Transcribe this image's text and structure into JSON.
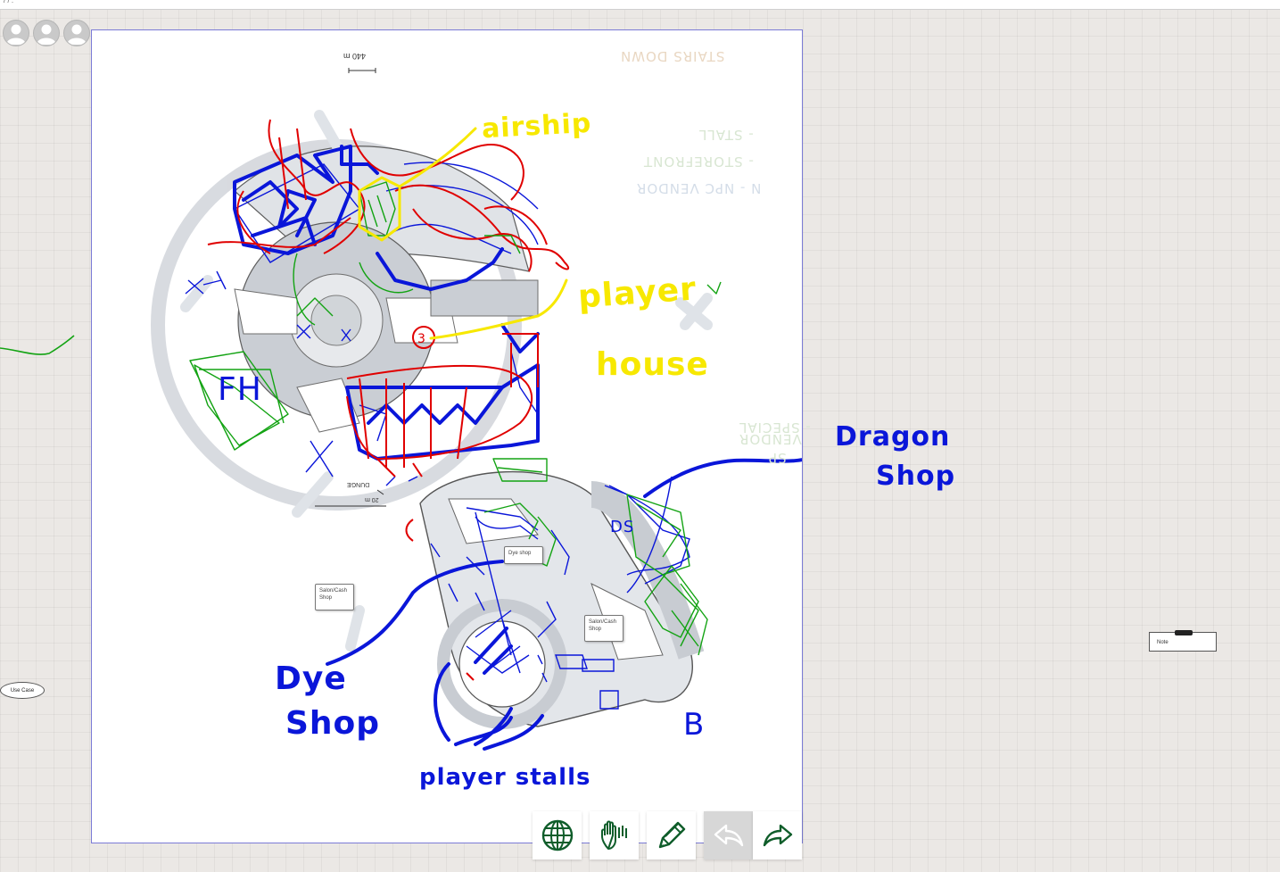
{
  "topbar": {
    "crumb": "/ / ."
  },
  "participants": [
    {
      "name": "avatar-1"
    },
    {
      "name": "avatar-2"
    },
    {
      "name": "avatar-3"
    }
  ],
  "board": {
    "scale_top": "440 m",
    "scale_bottom": "20 m",
    "scale_bottom_sub": "DUNGE",
    "legend": {
      "stairs": "STAIRS DOWN",
      "stall": "- STALL",
      "storefront": "- STOREFRONT",
      "npc_vendor": "N - NPC VENDOR",
      "special_vendor_1": "- SPECIAL",
      "special_vendor_2": "VENDOR",
      "sp": "SP"
    },
    "annotations": {
      "airship": "airship",
      "player": "player",
      "house": "house",
      "dragon": "Dragon",
      "dragon_shop": "Shop",
      "dye": "Dye",
      "dye_shop": "Shop",
      "player_stalls": "player stalls",
      "b": "B",
      "fh": "FH",
      "ds": "DS"
    },
    "callouts": {
      "salon1": "Salon/Cash Shop",
      "salon2": "Salon/Cash Shop",
      "dye_shop": "Dye shop"
    }
  },
  "nodes": {
    "note": "Note",
    "use_case": "Use Case"
  },
  "toolbar": {
    "globe": "globe-icon",
    "hand": "hand-icon",
    "pencil": "pencil-icon",
    "undo": "undo-icon",
    "redo": "redo-icon"
  },
  "colors": {
    "ink_blue": "#0a16d9",
    "ink_red": "#e00000",
    "ink_green": "#13a313",
    "ink_yellow": "#f7e800",
    "toolbar_icon": "#0f5d2a",
    "board_border": "#7b7bd6"
  }
}
